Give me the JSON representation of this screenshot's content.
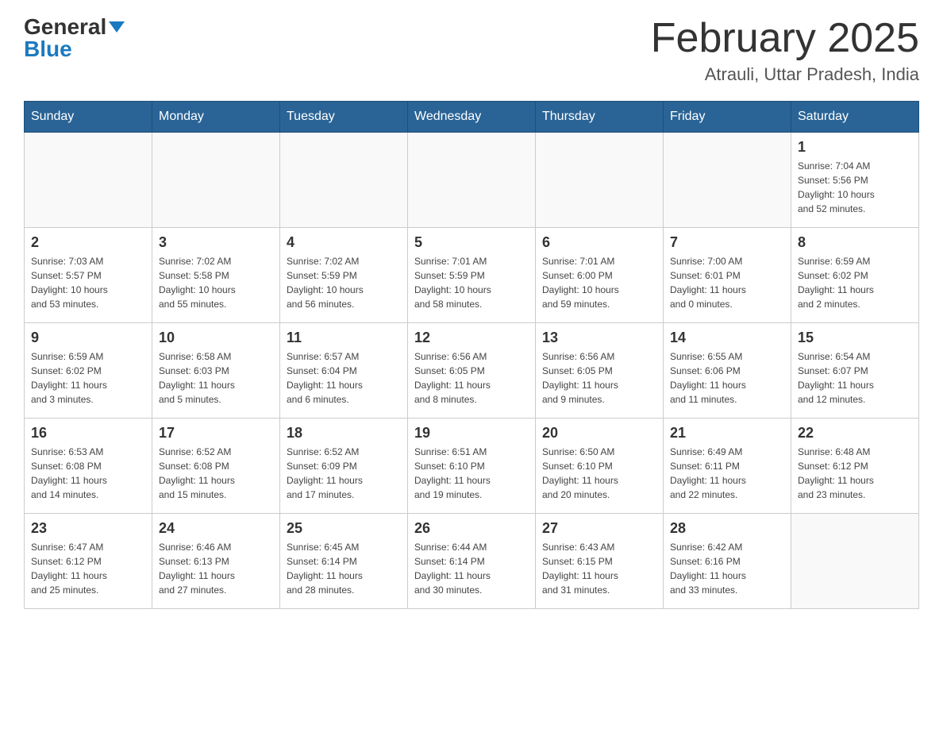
{
  "header": {
    "logo_general": "General",
    "logo_blue": "Blue",
    "month_title": "February 2025",
    "location": "Atrauli, Uttar Pradesh, India"
  },
  "weekdays": [
    "Sunday",
    "Monday",
    "Tuesday",
    "Wednesday",
    "Thursday",
    "Friday",
    "Saturday"
  ],
  "weeks": [
    [
      {
        "day": "",
        "info": ""
      },
      {
        "day": "",
        "info": ""
      },
      {
        "day": "",
        "info": ""
      },
      {
        "day": "",
        "info": ""
      },
      {
        "day": "",
        "info": ""
      },
      {
        "day": "",
        "info": ""
      },
      {
        "day": "1",
        "info": "Sunrise: 7:04 AM\nSunset: 5:56 PM\nDaylight: 10 hours\nand 52 minutes."
      }
    ],
    [
      {
        "day": "2",
        "info": "Sunrise: 7:03 AM\nSunset: 5:57 PM\nDaylight: 10 hours\nand 53 minutes."
      },
      {
        "day": "3",
        "info": "Sunrise: 7:02 AM\nSunset: 5:58 PM\nDaylight: 10 hours\nand 55 minutes."
      },
      {
        "day": "4",
        "info": "Sunrise: 7:02 AM\nSunset: 5:59 PM\nDaylight: 10 hours\nand 56 minutes."
      },
      {
        "day": "5",
        "info": "Sunrise: 7:01 AM\nSunset: 5:59 PM\nDaylight: 10 hours\nand 58 minutes."
      },
      {
        "day": "6",
        "info": "Sunrise: 7:01 AM\nSunset: 6:00 PM\nDaylight: 10 hours\nand 59 minutes."
      },
      {
        "day": "7",
        "info": "Sunrise: 7:00 AM\nSunset: 6:01 PM\nDaylight: 11 hours\nand 0 minutes."
      },
      {
        "day": "8",
        "info": "Sunrise: 6:59 AM\nSunset: 6:02 PM\nDaylight: 11 hours\nand 2 minutes."
      }
    ],
    [
      {
        "day": "9",
        "info": "Sunrise: 6:59 AM\nSunset: 6:02 PM\nDaylight: 11 hours\nand 3 minutes."
      },
      {
        "day": "10",
        "info": "Sunrise: 6:58 AM\nSunset: 6:03 PM\nDaylight: 11 hours\nand 5 minutes."
      },
      {
        "day": "11",
        "info": "Sunrise: 6:57 AM\nSunset: 6:04 PM\nDaylight: 11 hours\nand 6 minutes."
      },
      {
        "day": "12",
        "info": "Sunrise: 6:56 AM\nSunset: 6:05 PM\nDaylight: 11 hours\nand 8 minutes."
      },
      {
        "day": "13",
        "info": "Sunrise: 6:56 AM\nSunset: 6:05 PM\nDaylight: 11 hours\nand 9 minutes."
      },
      {
        "day": "14",
        "info": "Sunrise: 6:55 AM\nSunset: 6:06 PM\nDaylight: 11 hours\nand 11 minutes."
      },
      {
        "day": "15",
        "info": "Sunrise: 6:54 AM\nSunset: 6:07 PM\nDaylight: 11 hours\nand 12 minutes."
      }
    ],
    [
      {
        "day": "16",
        "info": "Sunrise: 6:53 AM\nSunset: 6:08 PM\nDaylight: 11 hours\nand 14 minutes."
      },
      {
        "day": "17",
        "info": "Sunrise: 6:52 AM\nSunset: 6:08 PM\nDaylight: 11 hours\nand 15 minutes."
      },
      {
        "day": "18",
        "info": "Sunrise: 6:52 AM\nSunset: 6:09 PM\nDaylight: 11 hours\nand 17 minutes."
      },
      {
        "day": "19",
        "info": "Sunrise: 6:51 AM\nSunset: 6:10 PM\nDaylight: 11 hours\nand 19 minutes."
      },
      {
        "day": "20",
        "info": "Sunrise: 6:50 AM\nSunset: 6:10 PM\nDaylight: 11 hours\nand 20 minutes."
      },
      {
        "day": "21",
        "info": "Sunrise: 6:49 AM\nSunset: 6:11 PM\nDaylight: 11 hours\nand 22 minutes."
      },
      {
        "day": "22",
        "info": "Sunrise: 6:48 AM\nSunset: 6:12 PM\nDaylight: 11 hours\nand 23 minutes."
      }
    ],
    [
      {
        "day": "23",
        "info": "Sunrise: 6:47 AM\nSunset: 6:12 PM\nDaylight: 11 hours\nand 25 minutes."
      },
      {
        "day": "24",
        "info": "Sunrise: 6:46 AM\nSunset: 6:13 PM\nDaylight: 11 hours\nand 27 minutes."
      },
      {
        "day": "25",
        "info": "Sunrise: 6:45 AM\nSunset: 6:14 PM\nDaylight: 11 hours\nand 28 minutes."
      },
      {
        "day": "26",
        "info": "Sunrise: 6:44 AM\nSunset: 6:14 PM\nDaylight: 11 hours\nand 30 minutes."
      },
      {
        "day": "27",
        "info": "Sunrise: 6:43 AM\nSunset: 6:15 PM\nDaylight: 11 hours\nand 31 minutes."
      },
      {
        "day": "28",
        "info": "Sunrise: 6:42 AM\nSunset: 6:16 PM\nDaylight: 11 hours\nand 33 minutes."
      },
      {
        "day": "",
        "info": ""
      }
    ]
  ]
}
